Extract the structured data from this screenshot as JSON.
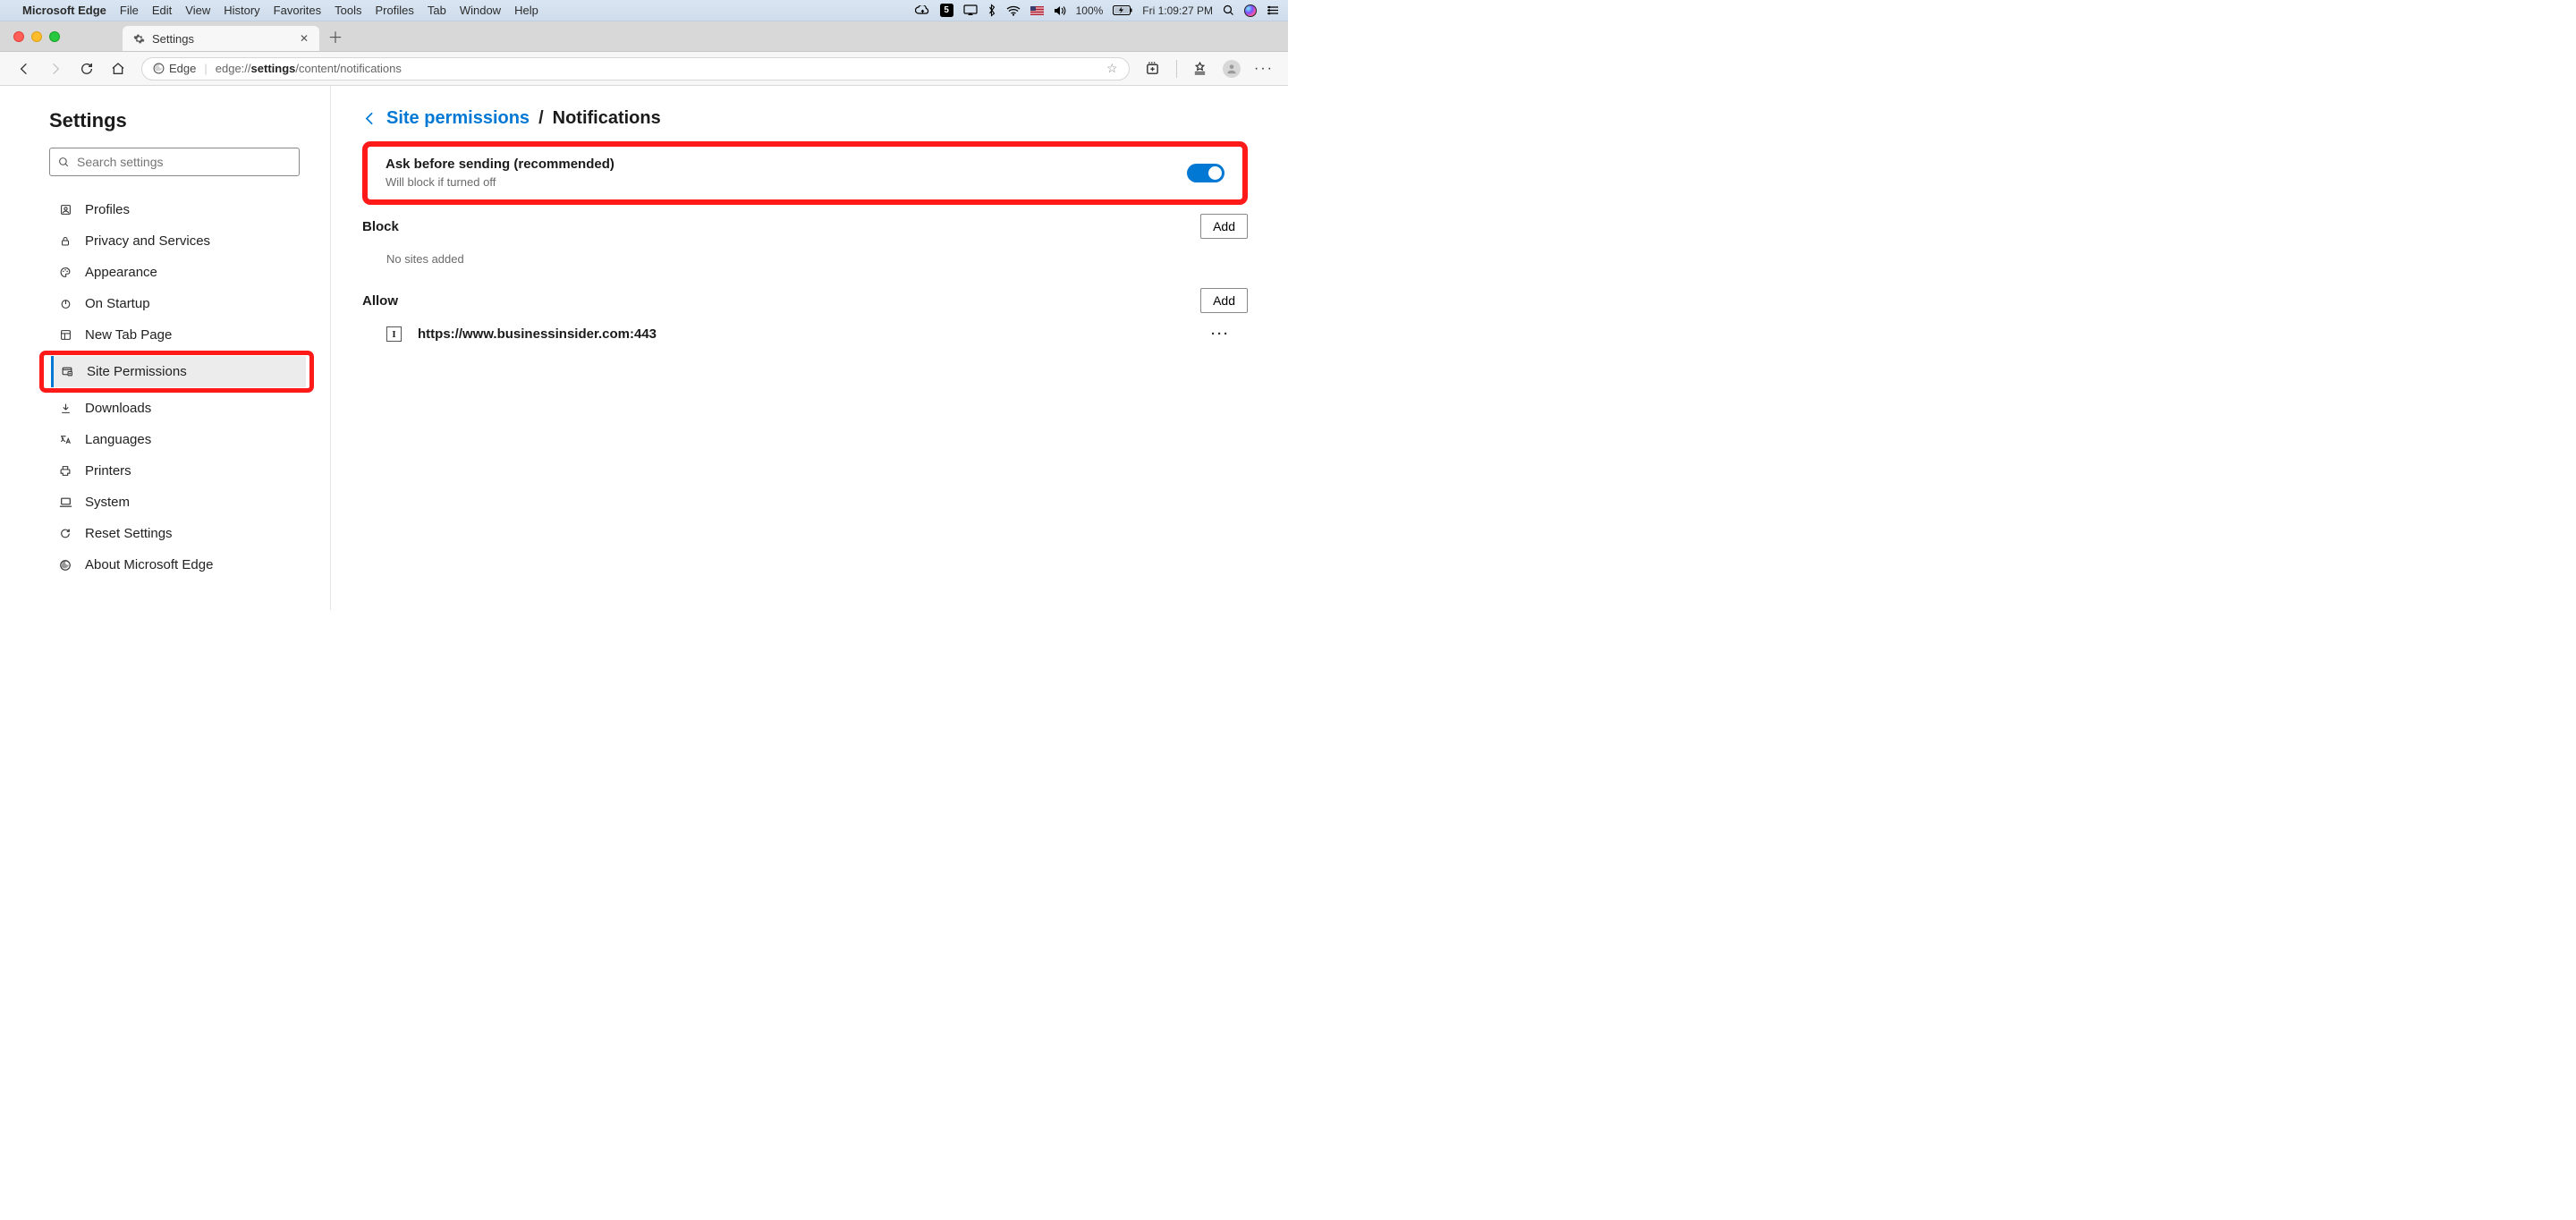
{
  "mac_menu": {
    "app": "Microsoft Edge",
    "items": [
      "File",
      "Edit",
      "View",
      "History",
      "Favorites",
      "Tools",
      "Profiles",
      "Tab",
      "Window",
      "Help"
    ],
    "battery": "100%",
    "clock": "Fri 1:09:27 PM"
  },
  "tab": {
    "title": "Settings"
  },
  "address": {
    "chip": "Edge",
    "prefix": "edge://",
    "bold": "settings",
    "suffix": "/content/notifications"
  },
  "sidebar": {
    "heading": "Settings",
    "search_placeholder": "Search settings",
    "items": [
      {
        "label": "Profiles"
      },
      {
        "label": "Privacy and Services"
      },
      {
        "label": "Appearance"
      },
      {
        "label": "On Startup"
      },
      {
        "label": "New Tab Page"
      },
      {
        "label": "Site Permissions"
      },
      {
        "label": "Downloads"
      },
      {
        "label": "Languages"
      },
      {
        "label": "Printers"
      },
      {
        "label": "System"
      },
      {
        "label": "Reset Settings"
      },
      {
        "label": "About Microsoft Edge"
      }
    ]
  },
  "main": {
    "crumb_link": "Site permissions",
    "crumb_leaf": "Notifications",
    "ask": {
      "title": "Ask before sending (recommended)",
      "sub": "Will block if turned off"
    },
    "block": {
      "heading": "Block",
      "add": "Add",
      "empty": "No sites added"
    },
    "allow": {
      "heading": "Allow",
      "add": "Add",
      "sites": [
        {
          "letter": "I",
          "url": "https://www.businessinsider.com:443"
        }
      ]
    }
  }
}
